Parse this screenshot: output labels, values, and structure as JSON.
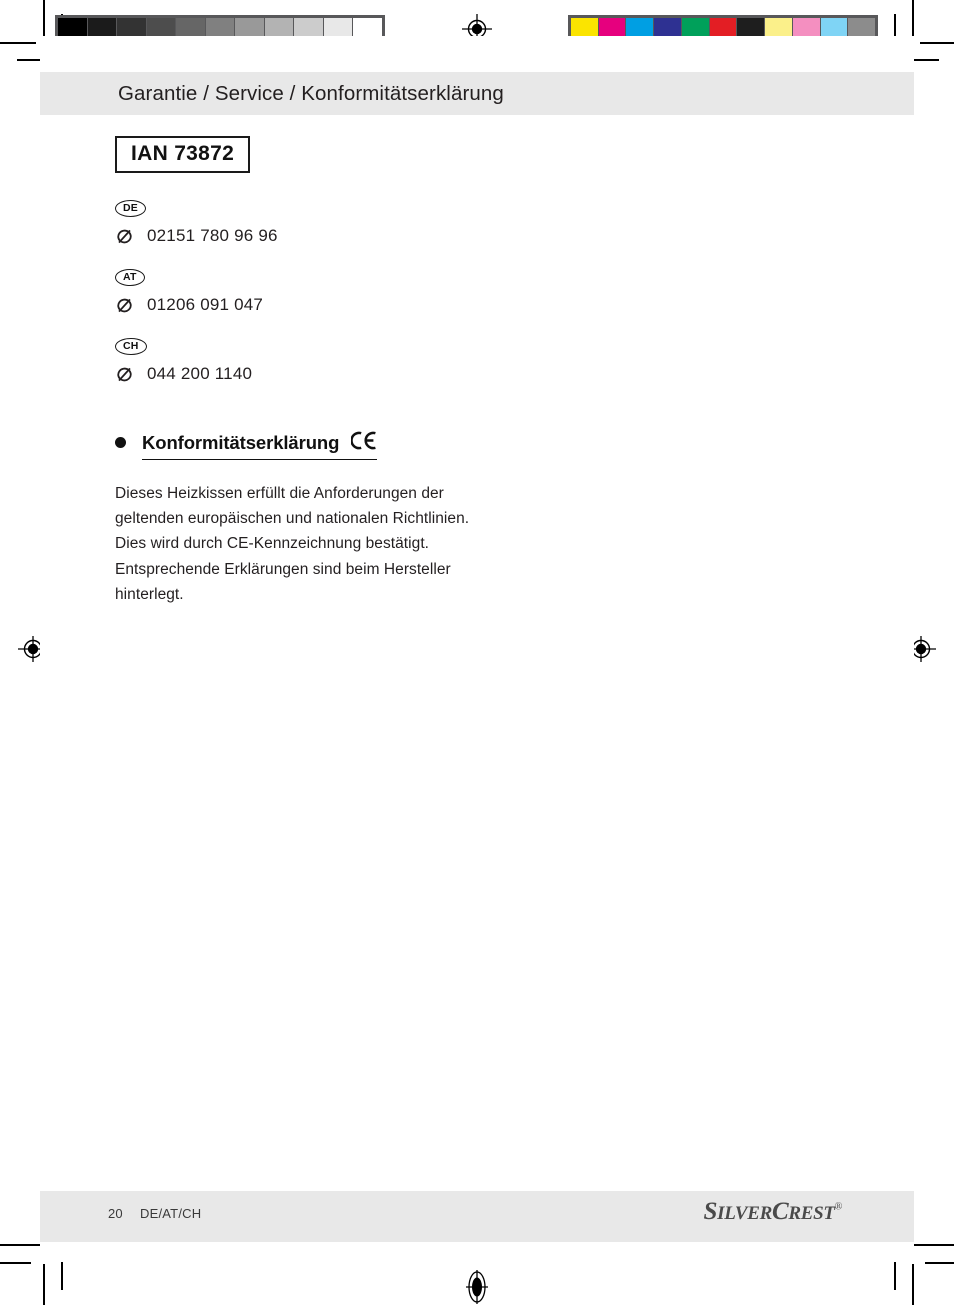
{
  "document": {
    "header_title": "Garantie / Service / Konformitätserklärung",
    "ian": "IAN 73872"
  },
  "contacts": [
    {
      "country_code": "DE",
      "phone": "02151 780 96 96",
      "icon": "telephone-icon"
    },
    {
      "country_code": "AT",
      "phone": "01206 091 047",
      "icon": "telephone-icon"
    },
    {
      "country_code": "CH",
      "phone": "044 200 1140",
      "icon": "telephone-icon"
    }
  ],
  "section": {
    "bullet": "bullet-icon",
    "title": "Konformitätserklärung",
    "ce_mark": "ce-mark-icon",
    "body_lines": [
      "Dieses Heizkissen erfüllt die Anforderungen der",
      "geltenden europäischen und nationalen Richtlinien.",
      "Dies wird durch CE-Kennzeichnung bestätigt.",
      "Entsprechende Erklärungen sind beim Hersteller",
      "hinterlegt."
    ]
  },
  "footer": {
    "page_number": "20",
    "region": "DE/AT/CH",
    "brand_silver": "SILVER",
    "brand_crest": "CREST",
    "brand_registered": "®"
  },
  "prepress": {
    "grayscale_swatches": [
      "#000000",
      "#1b1b1b",
      "#333333",
      "#4d4d4d",
      "#666666",
      "#808080",
      "#999999",
      "#b3b3b3",
      "#cccccc",
      "#e8e8e8",
      "#ffffff"
    ],
    "color_swatches": [
      "#fbe400",
      "#e6007e",
      "#009fe3",
      "#2e3192",
      "#00a05a",
      "#e31e24",
      "#1e1e1e",
      "#fbf08a",
      "#f happy",
      "#7fd4f5",
      "#8c8c8c"
    ],
    "color_swatches_fixed": [
      "#fbe400",
      "#e6007e",
      "#009fe3",
      "#2e3192",
      "#00a05a",
      "#e31e24",
      "#1e1e1e",
      "#fbf08a",
      "#f48fc0",
      "#7fd4f5",
      "#8c8c8c"
    ],
    "registration_mark": "registration-target-icon",
    "page_background": "#ffffff",
    "band_background": "#e8e8e8"
  }
}
